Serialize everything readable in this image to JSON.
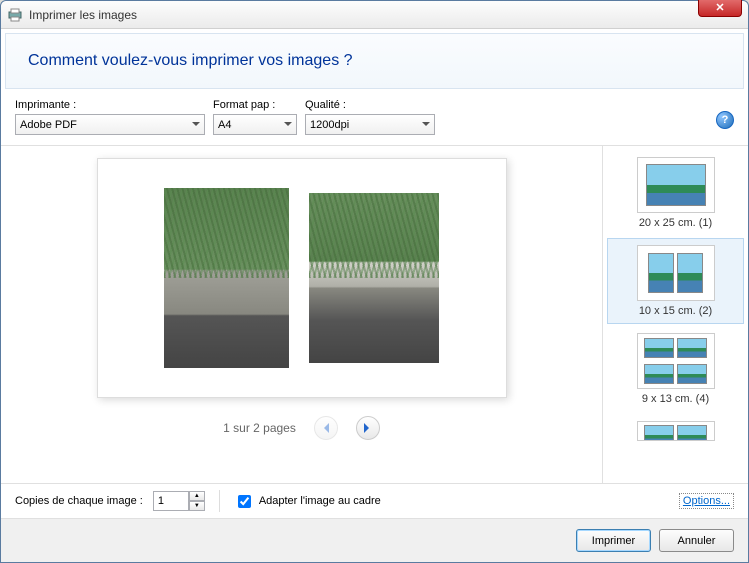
{
  "window": {
    "title": "Imprimer les images",
    "close_glyph": "✕"
  },
  "header": {
    "heading": "Comment voulez-vous imprimer vos images ?"
  },
  "controls": {
    "printer": {
      "label": "Imprimante :",
      "value": "Adobe PDF"
    },
    "paper": {
      "label": "Format pap :",
      "value": "A4"
    },
    "quality": {
      "label": "Qualité :",
      "value": "1200dpi"
    },
    "help_glyph": "?"
  },
  "pager": {
    "text": "1 sur 2 pages"
  },
  "layouts": [
    {
      "label": "20 x 25 cm. (1)",
      "cells": 1
    },
    {
      "label": "10 x 15 cm. (2)",
      "cells": 2
    },
    {
      "label": "9 x 13 cm. (4)",
      "cells": 4
    },
    {
      "label": "",
      "cells": 2
    }
  ],
  "footer": {
    "copies_label": "Copies de chaque image :",
    "copies_value": "1",
    "fit_label": "Adapter l'image au cadre",
    "options_link": "Options..."
  },
  "buttons": {
    "print": "Imprimer",
    "cancel": "Annuler"
  }
}
